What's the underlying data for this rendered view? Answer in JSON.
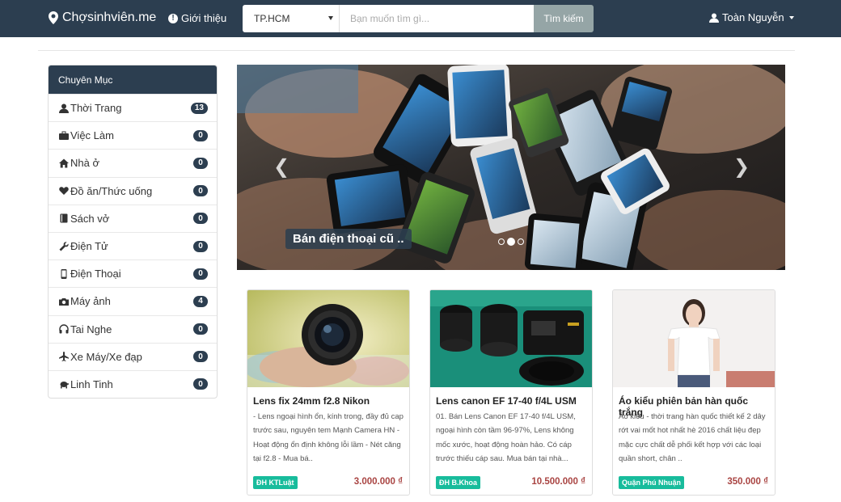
{
  "navbar": {
    "brand": "Chợsinhviên.me",
    "intro_link": "Giới thiệu",
    "location_select": "TP.HCM",
    "search_placeholder": "Bạn muốn tìm gì...",
    "search_button": "Tìm kiếm",
    "user_name": "Toàn Nguyễn"
  },
  "sidebar": {
    "title": "Chuyên Mục",
    "items": [
      {
        "label": "Thời Trang",
        "count": "13",
        "icon": "user-icon"
      },
      {
        "label": "Việc Làm",
        "count": "0",
        "icon": "briefcase-icon"
      },
      {
        "label": "Nhà ở",
        "count": "0",
        "icon": "home-icon"
      },
      {
        "label": "Đồ ăn/Thức uống",
        "count": "0",
        "icon": "heart-icon"
      },
      {
        "label": "Sách vở",
        "count": "0",
        "icon": "book-icon"
      },
      {
        "label": "Điện Tử",
        "count": "0",
        "icon": "wrench-icon"
      },
      {
        "label": "Điện Thoại",
        "count": "0",
        "icon": "phone-icon"
      },
      {
        "label": "Máy ảnh",
        "count": "4",
        "icon": "camera-icon"
      },
      {
        "label": "Tai Nghe",
        "count": "0",
        "icon": "headphones-icon"
      },
      {
        "label": "Xe Máy/Xe đạp",
        "count": "0",
        "icon": "plane-icon"
      },
      {
        "label": "Linh Tinh",
        "count": "0",
        "icon": "turtle-icon"
      }
    ]
  },
  "carousel": {
    "caption": "Bán điện thoại cũ ..",
    "slides": 3,
    "active_slide": 2
  },
  "products": [
    {
      "title": "Lens fix 24mm f2.8 Nikon",
      "description": "- Lens ngoại hình ổn, kính trong, đầy đủ cap trước sau, nguyên tem Mạnh Camera HN - Hoạt động ổn định không lỗi lầm - Nét căng tại f2.8 - Mua bá..",
      "location": "ĐH KTLuật",
      "price": "3.000.000 ₫"
    },
    {
      "title": "Lens canon EF 17-40 f/4L USM",
      "description": "01. Bán Lens Canon EF 17-40 f/4L USM, ngoại hình còn tầm 96-97%, Lens không mốc xước, hoạt động hoàn hảo. Có cáp trước thiếu cáp sau. Mua bán tại nhà...",
      "location": "ĐH B.Khoa",
      "price": "10.500.000 ₫"
    },
    {
      "title": "Áo kiểu phiên bản hàn quốc trắng",
      "description": "Áo kiểu - thời trang hàn quốc thiết kế 2 dây rớt vai mốt hot nhất hè 2016 chất liệu đẹp mặc cực chất dễ phối kết hợp với các loại quần short, chân ..",
      "location": "Quận Phú Nhuận",
      "price": "350.000 ₫"
    }
  ]
}
